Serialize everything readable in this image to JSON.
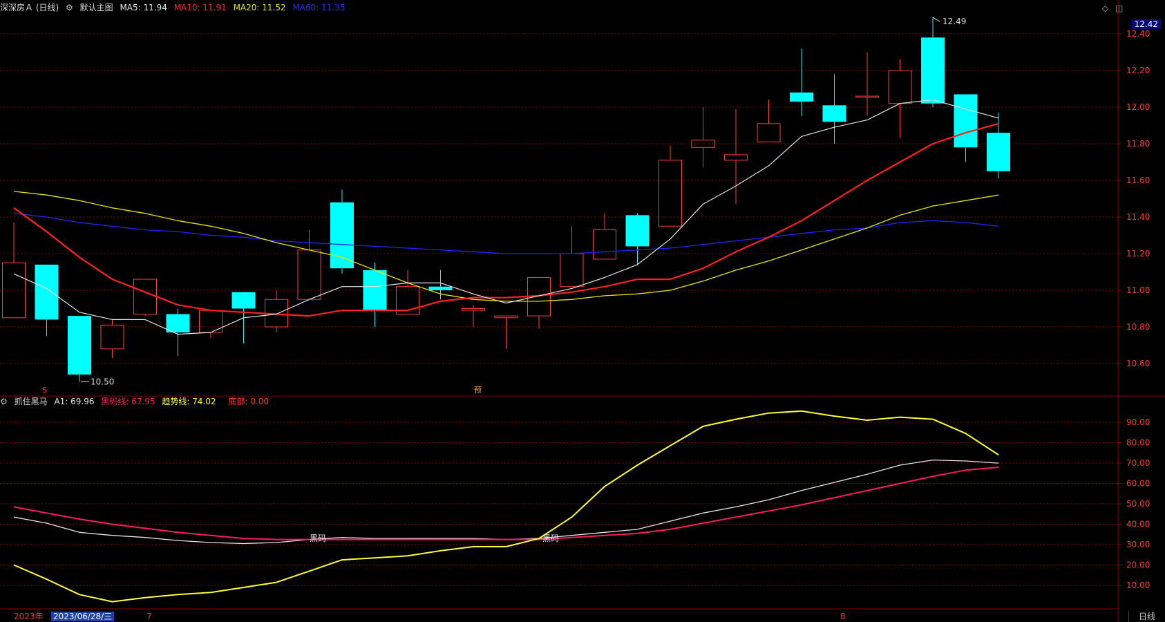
{
  "main_header": {
    "title": "深深房Ａ (日线)",
    "template": "默认主图",
    "ma5_label": "MA5: 11.94",
    "ma10_label": "MA10: 11.91",
    "ma20_label": "MA20: 11.52",
    "ma60_label": "MA60: 11.35"
  },
  "sub_header": {
    "title": "抓住黑马",
    "a1_label": "A1: 69.96",
    "hm_label": "黑码线: 67.95",
    "trend_label": "趋势线: 74.02",
    "bottom_label": "底部: 0.00"
  },
  "current_price": "12.42",
  "period_tab": "日线",
  "date_cursor": "2023/06/28/三",
  "x_labels": [
    "2023年",
    "7",
    "8"
  ],
  "annotations": {
    "high_label": "12.49",
    "low_label": "10.50",
    "sig_s": "S",
    "sig_mid": "预",
    "hm_text_1": "黑码",
    "hm_text_2": "黑码"
  },
  "colors": {
    "up": "#ff3b3b",
    "down": "#00ffff",
    "ma5": "#e6e6e6",
    "ma10": "#ff2020",
    "ma20": "#e6e600",
    "ma60": "#2222ff",
    "a1": "#e6e6e6",
    "hm": "#ff1a66",
    "trend": "#ffff33",
    "grid": "#8a0000",
    "axis_text": "#ff3b3b"
  },
  "chart_data": [
    {
      "type": "candlestick",
      "name": "深深房Ａ (日线)",
      "ylim": [
        10.45,
        12.5
      ],
      "yticks": [
        "12.40",
        "12.20",
        "12.00",
        "11.80",
        "11.60",
        "11.40",
        "11.20",
        "11.00",
        "10.80",
        "10.60"
      ],
      "ohlc": [
        [
          10.85,
          11.37,
          10.85,
          11.15
        ],
        [
          11.14,
          11.14,
          10.75,
          10.84
        ],
        [
          10.86,
          10.86,
          10.5,
          10.54
        ],
        [
          10.68,
          10.84,
          10.63,
          10.81
        ],
        [
          10.87,
          11.06,
          10.86,
          11.06
        ],
        [
          10.87,
          10.9,
          10.64,
          10.77
        ],
        [
          10.77,
          10.89,
          10.74,
          10.89
        ],
        [
          10.99,
          10.99,
          10.71,
          10.9
        ],
        [
          10.8,
          11.0,
          10.77,
          10.95
        ],
        [
          10.95,
          11.33,
          10.95,
          11.22
        ],
        [
          11.48,
          11.55,
          11.09,
          11.12
        ],
        [
          11.11,
          11.15,
          10.8,
          10.89
        ],
        [
          10.87,
          11.11,
          10.87,
          11.02
        ],
        [
          11.02,
          11.11,
          10.95,
          11.0
        ],
        [
          10.89,
          10.92,
          10.8,
          10.9
        ],
        [
          10.85,
          10.86,
          10.68,
          10.86
        ],
        [
          10.86,
          11.07,
          10.79,
          11.07
        ],
        [
          11.02,
          11.35,
          11.02,
          11.2
        ],
        [
          11.17,
          11.42,
          11.17,
          11.33
        ],
        [
          11.41,
          11.42,
          11.14,
          11.24
        ],
        [
          11.35,
          11.79,
          11.35,
          11.71
        ],
        [
          11.78,
          12.0,
          11.67,
          11.82
        ],
        [
          11.71,
          11.99,
          11.47,
          11.74
        ],
        [
          11.81,
          12.04,
          11.81,
          11.91
        ],
        [
          12.08,
          12.32,
          11.95,
          12.03
        ],
        [
          12.01,
          12.18,
          11.8,
          11.92
        ],
        [
          12.06,
          12.3,
          11.95,
          12.06
        ],
        [
          12.02,
          12.26,
          11.83,
          12.2
        ],
        [
          12.38,
          12.49,
          12.0,
          12.02
        ],
        [
          12.07,
          12.07,
          11.7,
          11.78
        ],
        [
          11.86,
          11.97,
          11.61,
          11.65
        ]
      ],
      "ma5": [
        11.09,
        11.01,
        10.88,
        10.84,
        10.84,
        10.76,
        10.77,
        10.85,
        10.87,
        10.95,
        11.02,
        11.02,
        11.04,
        11.04,
        10.98,
        10.93,
        10.97,
        11.01,
        11.07,
        11.14,
        11.28,
        11.47,
        11.57,
        11.68,
        11.84,
        11.89,
        11.93,
        12.02,
        12.04,
        11.99,
        11.94
      ],
      "ma10": [
        11.45,
        11.32,
        11.18,
        11.06,
        10.99,
        10.92,
        10.89,
        10.88,
        10.87,
        10.86,
        10.89,
        10.89,
        10.89,
        10.94,
        10.96,
        10.96,
        10.97,
        10.99,
        11.02,
        11.06,
        11.06,
        11.12,
        11.21,
        11.29,
        11.38,
        11.49,
        11.6,
        11.7,
        11.8,
        11.86,
        11.91
      ],
      "ma20": [
        11.54,
        11.52,
        11.49,
        11.45,
        11.42,
        11.38,
        11.35,
        11.31,
        11.26,
        11.22,
        11.18,
        11.11,
        11.04,
        10.98,
        10.95,
        10.94,
        10.94,
        10.95,
        10.97,
        10.98,
        11.0,
        11.05,
        11.11,
        11.16,
        11.22,
        11.28,
        11.34,
        11.41,
        11.46,
        11.49,
        11.52
      ],
      "ma60": [
        11.42,
        11.4,
        11.37,
        11.35,
        11.33,
        11.32,
        11.3,
        11.29,
        11.27,
        11.26,
        11.25,
        11.24,
        11.23,
        11.22,
        11.21,
        11.2,
        11.2,
        11.2,
        11.21,
        11.22,
        11.23,
        11.25,
        11.27,
        11.29,
        11.31,
        11.33,
        11.34,
        11.37,
        11.38,
        11.37,
        11.35
      ]
    },
    {
      "type": "line",
      "name": "抓住黑马",
      "ylim": [
        0,
        100
      ],
      "yticks": [
        "90.00",
        "80.00",
        "70.00",
        "60.00",
        "50.00",
        "40.00",
        "30.00",
        "20.00",
        "10.00"
      ],
      "series": [
        {
          "name": "A1",
          "values": [
            43.5,
            40.5,
            36.0,
            34.5,
            33.5,
            32.0,
            31.0,
            30.5,
            31.0,
            32.5,
            33.5,
            33.0,
            33.0,
            33.0,
            33.0,
            32.5,
            33.0,
            34.5,
            36.0,
            37.5,
            41.5,
            45.5,
            48.5,
            52.0,
            56.5,
            60.5,
            64.5,
            69.0,
            71.5,
            71.0,
            69.96
          ]
        },
        {
          "name": "黑码线",
          "values": [
            48.5,
            45.5,
            42.5,
            40.0,
            38.0,
            36.0,
            34.5,
            33.0,
            32.5,
            32.5,
            32.5,
            32.5,
            32.5,
            32.5,
            32.5,
            32.5,
            32.5,
            33.5,
            34.5,
            35.5,
            37.5,
            40.5,
            43.5,
            46.5,
            49.5,
            53.0,
            56.5,
            60.0,
            63.5,
            66.5,
            67.95
          ]
        },
        {
          "name": "趋势线",
          "values": [
            20.0,
            13.0,
            5.5,
            2.0,
            4.0,
            5.5,
            6.5,
            9.0,
            11.5,
            17.0,
            22.5,
            23.5,
            24.5,
            27.0,
            29.0,
            29.0,
            33.0,
            43.5,
            58.5,
            69.0,
            78.5,
            88.0,
            91.5,
            94.5,
            95.5,
            93.0,
            91.0,
            92.5,
            91.5,
            84.5,
            74.02
          ]
        }
      ]
    }
  ]
}
